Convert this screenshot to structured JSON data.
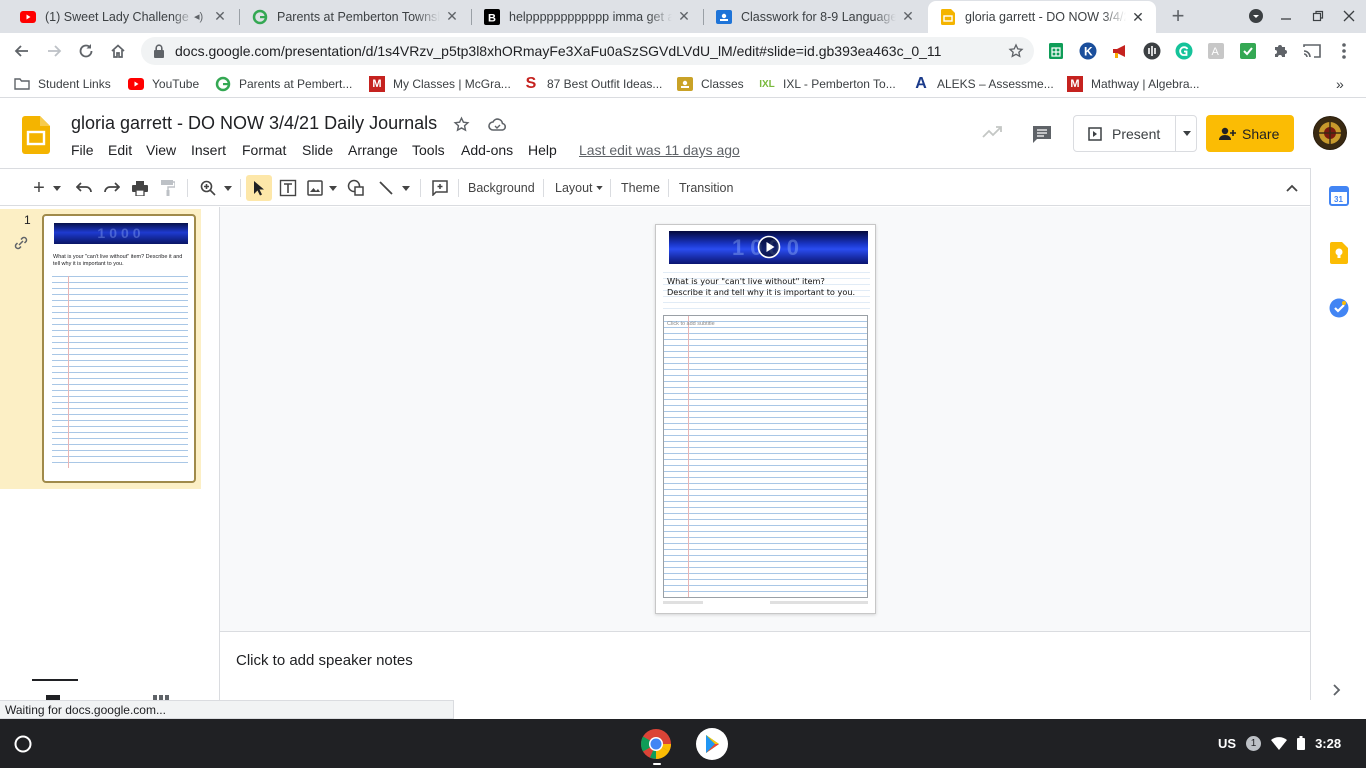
{
  "browser": {
    "tabs": [
      {
        "title": "(1) Sweet Lady Challenge -",
        "icon": "youtube-icon"
      },
      {
        "title": "Parents at Pemberton Townshi",
        "icon": "google-g-icon"
      },
      {
        "title": "helpppppppppppp imma get a",
        "icon": "brainly-icon"
      },
      {
        "title": "Classwork for 8-9 Language N",
        "icon": "classroom-icon"
      },
      {
        "title": "gloria garrett - DO NOW 3/4/21",
        "icon": "slides-icon"
      }
    ],
    "url": "docs.google.com/presentation/d/1s4VRzv_p5tp3l8xhORmayFe3XaFu0aSzSGVdLVdU_lM/edit#slide=id.gb393ea463c_0_11",
    "bookmarks": [
      {
        "label": "Student Links",
        "icon": "folder-icon"
      },
      {
        "label": "YouTube",
        "icon": "youtube-icon"
      },
      {
        "label": "Parents at Pembert...",
        "icon": "google-g-icon"
      },
      {
        "label": "My Classes | McGra...",
        "icon": "mcgraw-icon"
      },
      {
        "label": "87 Best Outfit Ideas...",
        "icon": "shein-icon"
      },
      {
        "label": "Classes",
        "icon": "classes-icon"
      },
      {
        "label": "IXL - Pemberton To...",
        "icon": "ixl-icon"
      },
      {
        "label": "ALEKS – Assessme...",
        "icon": "aleks-icon"
      },
      {
        "label": "Mathway | Algebra...",
        "icon": "mathway-icon"
      }
    ],
    "status": "Waiting for docs.google.com..."
  },
  "docs": {
    "title": "gloria garrett - DO NOW 3/4/21 Daily Journals",
    "menus": [
      "File",
      "Edit",
      "View",
      "Insert",
      "Format",
      "Slide",
      "Arrange",
      "Tools",
      "Add-ons",
      "Help"
    ],
    "last_edit": "Last edit was 11 days ago",
    "present_label": "Present",
    "share_label": "Share"
  },
  "toolbar": {
    "background": "Background",
    "layout": "Layout",
    "theme": "Theme",
    "transition": "Transition"
  },
  "filmstrip": {
    "slide_number": "1"
  },
  "slide": {
    "banner_text": "1000",
    "question": "What is your \"can't live without\" item? Describe it and tell why it is important to you.",
    "subtitle_placeholder": "Click to add subtitle"
  },
  "notes": {
    "placeholder": "Click to add speaker notes"
  },
  "shelf": {
    "lang": "US",
    "notif_count": "1",
    "time": "3:28"
  },
  "colors": {
    "share_yellow": "#fbbc04",
    "filmstrip_selected": "#fcefc5",
    "slides_yellow": "#f4b400",
    "shelf_bg": "#202124"
  }
}
